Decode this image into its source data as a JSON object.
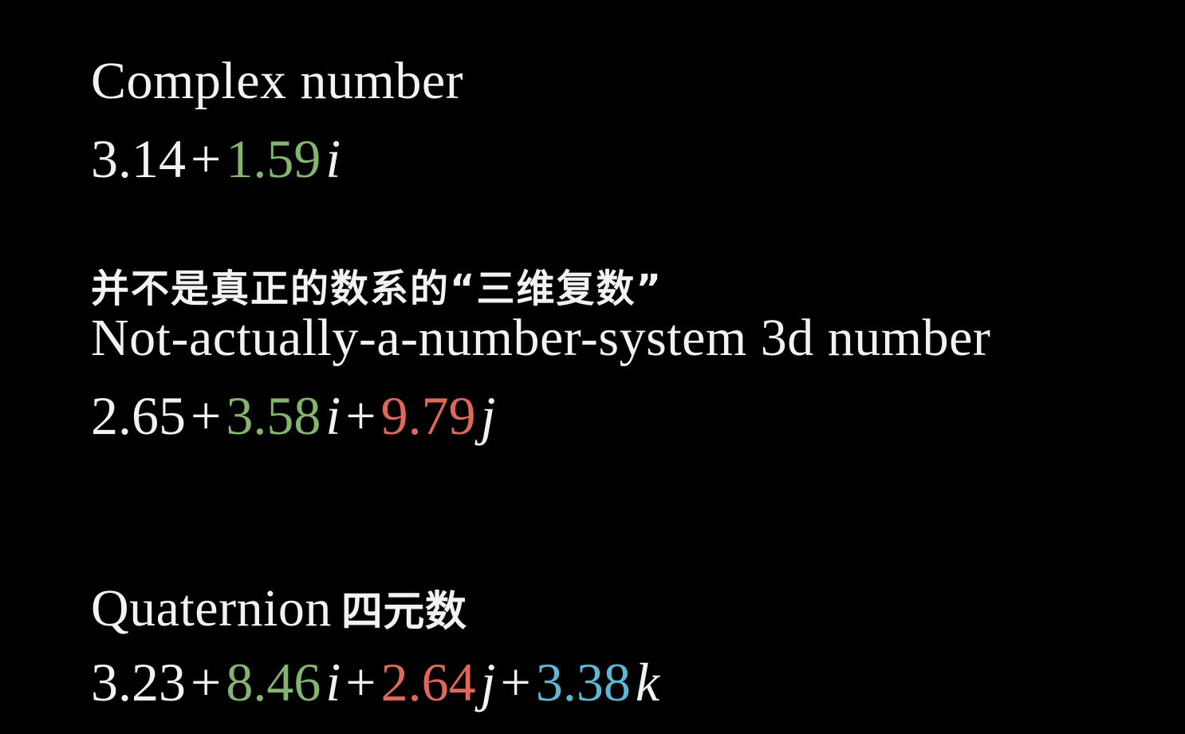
{
  "colors": {
    "background": "#000000",
    "text": "#f2f2f2",
    "i_coefficient": "#83b56f",
    "j_coefficient": "#e0685a",
    "k_coefficient": "#5cb8d4"
  },
  "complex": {
    "title": "Complex number",
    "real": "3.14",
    "plus1": "+",
    "i_coef": "1.59",
    "i_unit": "i"
  },
  "three_d": {
    "caption_zh": "并不是真正的数系的“三维复数”",
    "title": "Not-actually-a-number-system 3d number",
    "real": "2.65",
    "plus1": "+",
    "i_coef": "3.58",
    "i_unit": "i",
    "plus2": "+",
    "j_coef": "9.79",
    "j_unit": "j"
  },
  "quaternion": {
    "title": "Quaternion",
    "title_zh": "四元数",
    "real": "3.23",
    "plus1": "+",
    "i_coef": "8.46",
    "i_unit": "i",
    "plus2": "+",
    "j_coef": "2.64",
    "j_unit": "j",
    "plus3": "+",
    "k_coef": "3.38",
    "k_unit": "k"
  }
}
